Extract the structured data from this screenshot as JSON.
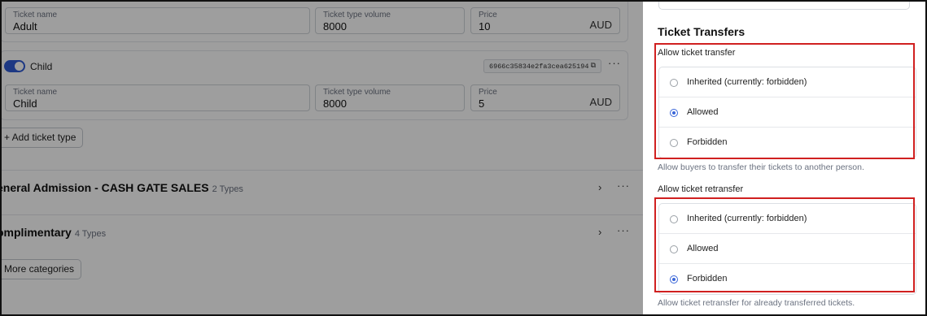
{
  "tickets": [
    {
      "name_label": "Ticket name",
      "name_value": "Adult",
      "volume_label": "Ticket type volume",
      "volume_value": "8000",
      "price_label": "Price",
      "price_value": "10",
      "currency": "AUD"
    },
    {
      "toggle_label": "Child",
      "hash": "6966c35834e2fa3cea625194",
      "name_label": "Ticket name",
      "name_value": "Child",
      "volume_label": "Ticket type volume",
      "volume_value": "8000",
      "price_label": "Price",
      "price_value": "5",
      "currency": "AUD"
    }
  ],
  "add_ticket_type_label": "+ Add ticket type",
  "categories": [
    {
      "title": "eneral Admission - CASH GATE SALES",
      "count": "2 Types"
    },
    {
      "title": "omplimentary",
      "count": "4 Types"
    }
  ],
  "more_categories_label": "More categories",
  "panel": {
    "section_title": "Ticket Transfers",
    "transfer": {
      "label": "Allow ticket transfer",
      "options": [
        "Inherited (currently: forbidden)",
        "Allowed",
        "Forbidden"
      ],
      "selected": 1,
      "help": "Allow buyers to transfer their tickets to another person."
    },
    "retransfer": {
      "label": "Allow ticket retransfer",
      "options": [
        "Inherited (currently: forbidden)",
        "Allowed",
        "Forbidden"
      ],
      "selected": 2,
      "help": "Allow ticket retransfer for already transferred tickets."
    }
  },
  "colors": {
    "accent": "#3a66d8",
    "highlight": "#d02020",
    "overlay": "rgba(0,0,0,0.38)"
  }
}
